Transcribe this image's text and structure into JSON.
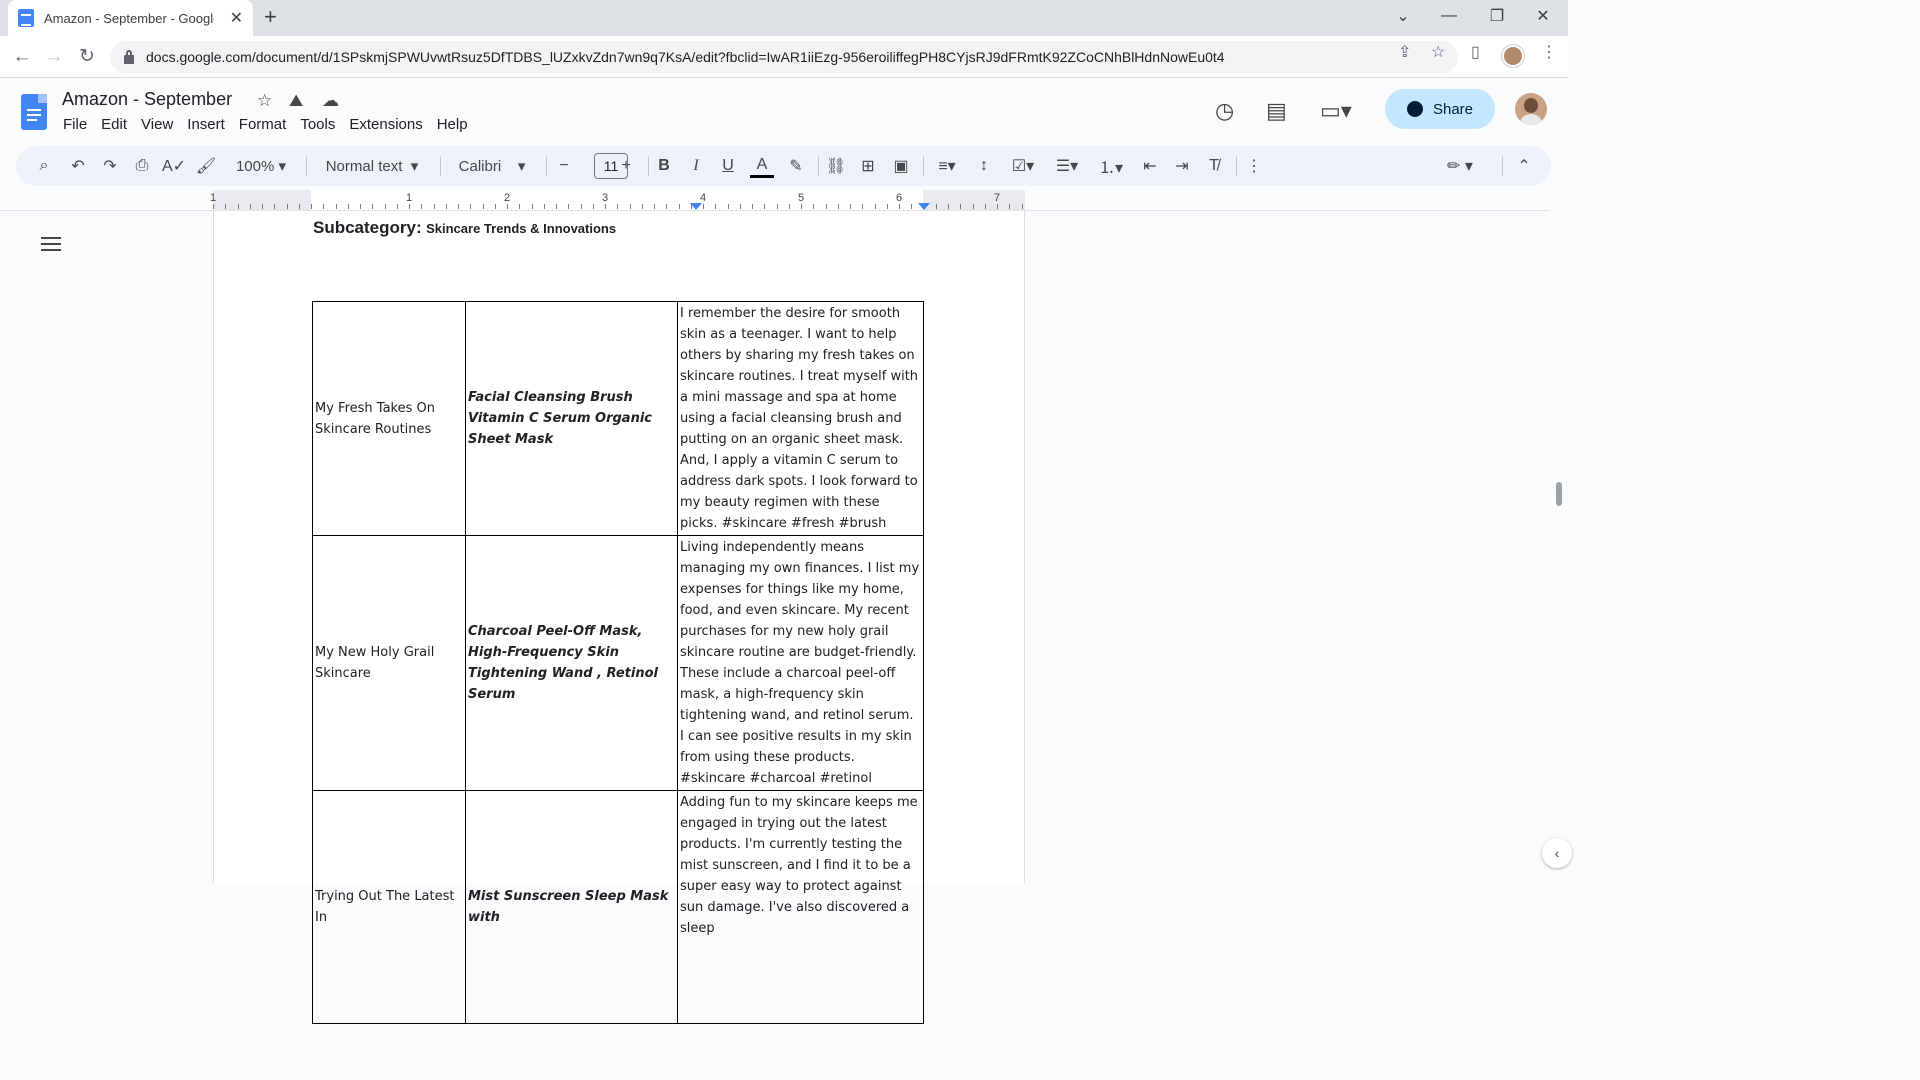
{
  "browser": {
    "tab_title": "Amazon - September - Google D",
    "tab_close": "✕",
    "new_tab": "+",
    "url": "docs.google.com/document/d/1SPskmjSPWUvwtRsuz5DfTDBS_lUZxkvZdn7wn9q7KsA/edit?fbclid=IwAR1iiEzg-956eroiliffegPH8CYjsRJ9dFRmtK92ZCoCNhBlHdnNowEu0t4",
    "window_controls": [
      "⌄",
      "—",
      "❐",
      "✕"
    ]
  },
  "docs": {
    "title": "Amazon - September",
    "menu": [
      "File",
      "Edit",
      "View",
      "Insert",
      "Format",
      "Tools",
      "Extensions",
      "Help"
    ],
    "share_label": "Share"
  },
  "toolbar": {
    "zoom": "100%",
    "style": "Normal text",
    "font": "Calibri",
    "font_size": "11"
  },
  "ruler": {
    "numbers": [
      "1",
      "1",
      "2",
      "3",
      "4",
      "5",
      "6",
      "7"
    ]
  },
  "document": {
    "subcategory_label": "Subcategory:",
    "subcategory_value": "Skincare Trends & Innovations",
    "rows": [
      {
        "title": "My Fresh Takes On Skincare Routines",
        "products": "Facial Cleansing Brush   Vitamin C Serum            Organic Sheet Mask",
        "description": "I remember the desire for smooth skin as a teenager. I want to help others by sharing my fresh takes on skincare routines. I treat myself with a mini massage and spa at home using a facial cleansing brush and putting on an organic sheet mask. And, I apply a vitamin C serum to address dark spots. I look forward to my beauty regimen with these picks. #skincare #fresh #brush"
      },
      {
        "title": "My New Holy Grail Skincare",
        "products": "Charcoal Peel-Off Mask, High-Frequency Skin Tightening Wand   , Retinol Serum",
        "description": "Living independently means managing my own finances. I list my expenses for things like my home, food, and even skincare. My recent purchases for my new holy grail skincare routine are budget-friendly. These include a charcoal peel-off mask, a high-frequency skin tightening wand, and retinol serum. I can see positive results in my skin from using these products. #skincare #charcoal #retinol"
      },
      {
        "title": "Trying Out The Latest In",
        "products": "Mist Sunscreen Sleep Mask with",
        "description": "Adding fun to my skincare keeps me engaged in trying out the latest products. I'm currently testing the mist sunscreen, and I find it to be a super easy way to protect against sun damage. I've also discovered a sleep"
      }
    ]
  }
}
